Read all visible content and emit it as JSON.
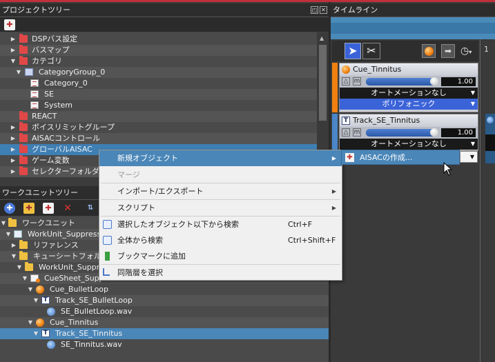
{
  "project_tree": {
    "title": "プロジェクトツリー",
    "items": [
      {
        "label": "DSPバス設定"
      },
      {
        "label": "バスマップ"
      },
      {
        "label": "カテゴリ"
      },
      {
        "label": "CategoryGroup_0"
      },
      {
        "label": "Category_0"
      },
      {
        "label": "SE"
      },
      {
        "label": "System"
      },
      {
        "label": "REACT"
      },
      {
        "label": "ボイスリミットグループ"
      },
      {
        "label": "AISACコントロール"
      },
      {
        "label": "グローバルAISAC"
      },
      {
        "label": "ゲーム変数"
      },
      {
        "label": "セレクターフォルダー"
      }
    ]
  },
  "workunit_tree": {
    "title": "ワークユニットツリー",
    "items": [
      {
        "label": "ワークユニット"
      },
      {
        "label": "WorkUnit_Suppress"
      },
      {
        "label": "リファレンス"
      },
      {
        "label": "キューシートフォルダー"
      },
      {
        "label": "WorkUnit_Suppr"
      },
      {
        "label": "CueSheet_Suppre"
      },
      {
        "label": "Cue_BulletLoop"
      },
      {
        "label": "Track_SE_BulletLoop"
      },
      {
        "label": "SE_BulletLoop.wav"
      },
      {
        "label": "Cue_Tinnitus"
      },
      {
        "label": "Track_SE_Tinnitus"
      },
      {
        "label": "SE_Tinnitus.wav"
      }
    ]
  },
  "timeline": {
    "title": "タイムライン",
    "cue": {
      "name": "Cue_Tinnitus",
      "volume": "1.00",
      "automation": "オートメーションなし",
      "mode": "ポリフォニック"
    },
    "track": {
      "name": "Track_SE_Tinnitus",
      "volume": "1.00",
      "automation": "オートメーションなし"
    },
    "ruler_mark": "1"
  },
  "context_menu": {
    "items": [
      {
        "label": "新規オブジェクト",
        "shortcut": ""
      },
      {
        "label": "マージ",
        "shortcut": ""
      },
      {
        "label": "インポート/エクスポート",
        "shortcut": ""
      },
      {
        "label": "スクリプト",
        "shortcut": ""
      },
      {
        "label": "選択したオブジェクト以下から検索",
        "shortcut": "Ctrl+F"
      },
      {
        "label": "全体から検索",
        "shortcut": "Ctrl+Shift+F"
      },
      {
        "label": "ブックマークに追加",
        "shortcut": ""
      },
      {
        "label": "同階層を選択",
        "shortcut": ""
      }
    ],
    "submenu": {
      "label": "AISACの作成..."
    }
  }
}
